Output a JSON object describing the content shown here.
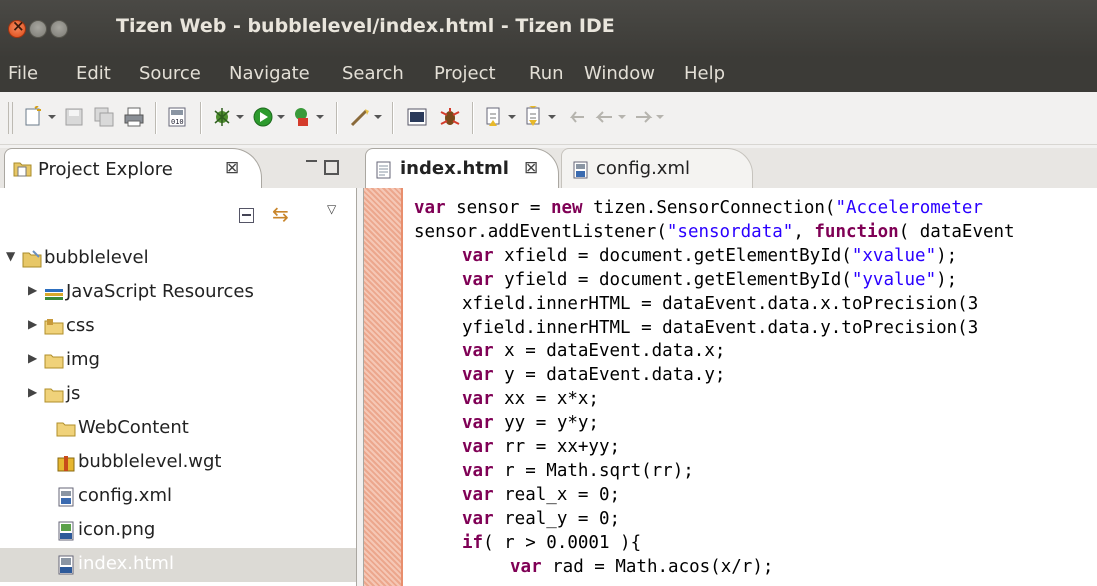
{
  "window": {
    "title": "Tizen Web - bubblelevel/index.html - Tizen IDE"
  },
  "menubar": {
    "items": [
      {
        "label": "File"
      },
      {
        "label": "Edit"
      },
      {
        "label": "Source"
      },
      {
        "label": "Navigate"
      },
      {
        "label": "Search"
      },
      {
        "label": "Project"
      },
      {
        "label": "Run"
      },
      {
        "label": "Window"
      },
      {
        "label": "Help"
      }
    ]
  },
  "project_explorer": {
    "tab_label": "Project Explore",
    "tab_close": "⊠",
    "tree": [
      {
        "label": "bubblelevel",
        "icon": "project-folder-icon",
        "expanded": true
      },
      {
        "label": "JavaScript Resources",
        "icon": "library-icon",
        "expanded": false
      },
      {
        "label": "css",
        "icon": "folder-icon",
        "expanded": false
      },
      {
        "label": "img",
        "icon": "folder-icon",
        "expanded": false
      },
      {
        "label": "js",
        "icon": "folder-icon",
        "expanded": false
      },
      {
        "label": "WebContent",
        "icon": "folder-icon"
      },
      {
        "label": "bubblelevel.wgt",
        "icon": "package-icon"
      },
      {
        "label": "config.xml",
        "icon": "xml-file-icon"
      },
      {
        "label": "icon.png",
        "icon": "png-file-icon"
      },
      {
        "label": "index.html",
        "icon": "html-file-icon",
        "selected": true
      }
    ]
  },
  "editor": {
    "tabs": [
      {
        "label": "index.html",
        "close": "⊠",
        "active": true
      },
      {
        "label": "config.xml",
        "active": false
      }
    ],
    "code_lines": [
      {
        "kw": "var",
        "rest": " sensor = ",
        "kw2": "new",
        "rest2": " tizen.SensorConnection(",
        "str": "\"Accelerometer",
        "rest3": ""
      },
      {
        "kw": "",
        "rest": "sensor.addEventListener(",
        "kw2": "",
        "rest2": "",
        "str": "\"sensordata\"",
        "rest3": ", ",
        "kw3": "function",
        "rest4": "( dataEvent"
      },
      {
        "indent": true,
        "kw": "var",
        "rest": " xfield = document.getElementById(",
        "str": "\"xvalue\"",
        "rest3": ");"
      },
      {
        "indent": true,
        "kw": "var",
        "rest": " yfield = document.getElementById(",
        "str": "\"yvalue\"",
        "rest3": ");"
      },
      {
        "indent": true,
        "kw": "",
        "rest": "xfield.innerHTML = dataEvent.data.x.toPrecision(",
        "str": "",
        "rest3": "3"
      },
      {
        "indent": true,
        "kw": "",
        "rest": "yfield.innerHTML = dataEvent.data.y.toPrecision(",
        "str": "",
        "rest3": "3"
      },
      {
        "indent": true,
        "kw": "var",
        "rest": " x = dataEvent.data.x;"
      },
      {
        "indent": true,
        "kw": "var",
        "rest": " y = dataEvent.data.y;"
      },
      {
        "indent": true,
        "kw": "var",
        "rest": " xx = x*x;"
      },
      {
        "indent": true,
        "kw": "var",
        "rest": " yy = y*y;"
      },
      {
        "indent": true,
        "kw": "var",
        "rest": " rr = xx+yy;"
      },
      {
        "indent": true,
        "kw": "var",
        "rest": " r = Math.sqrt(rr);"
      },
      {
        "indent": true,
        "kw": "var",
        "rest": " real_x = 0;"
      },
      {
        "indent": true,
        "kw": "var",
        "rest": " real_y = 0;"
      },
      {
        "indent": true,
        "kw": "if",
        "rest": "( r > 0.0001 ){"
      },
      {
        "indent2": true,
        "kw": "var",
        "rest": " rad = Math.acos(x/r);"
      }
    ]
  }
}
